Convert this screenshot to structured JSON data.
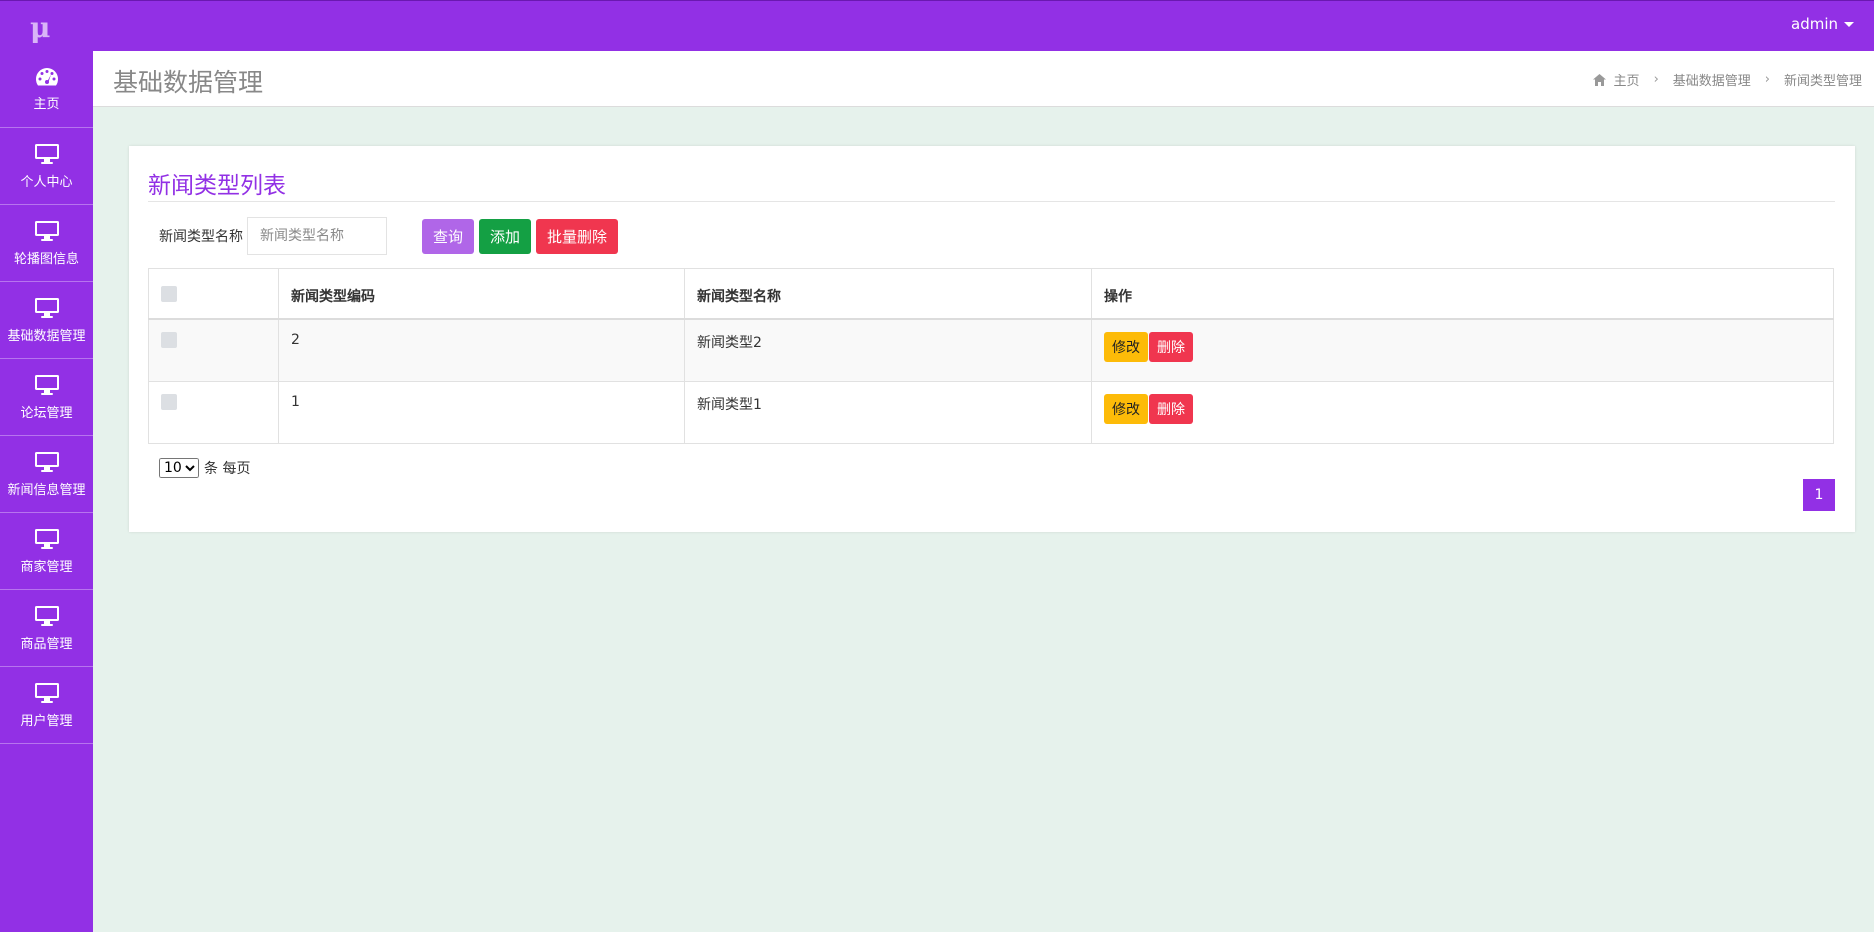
{
  "app": {
    "logo": "μ",
    "user": "admin"
  },
  "colors": {
    "brand": "#9230e5",
    "content_bg": "#e6f2ec",
    "query": "#b066e8",
    "add": "#14a044",
    "delete": "#f0364f",
    "edit": "#fdbb08"
  },
  "sidebar": {
    "items": [
      {
        "label": "主页",
        "icon": "dashboard-icon"
      },
      {
        "label": "个人中心",
        "icon": "monitor-icon"
      },
      {
        "label": "轮播图信息",
        "icon": "monitor-icon"
      },
      {
        "label": "基础数据管理",
        "icon": "monitor-icon"
      },
      {
        "label": "论坛管理",
        "icon": "monitor-icon"
      },
      {
        "label": "新闻信息管理",
        "icon": "monitor-icon"
      },
      {
        "label": "商家管理",
        "icon": "monitor-icon"
      },
      {
        "label": "商品管理",
        "icon": "monitor-icon"
      },
      {
        "label": "用户管理",
        "icon": "monitor-icon"
      }
    ]
  },
  "header": {
    "title": "基础数据管理",
    "breadcrumb": [
      "主页",
      "基础数据管理",
      "新闻类型管理"
    ]
  },
  "card": {
    "title": "新闻类型列表",
    "search": {
      "label": "新闻类型名称",
      "placeholder": "新闻类型名称",
      "value": ""
    },
    "buttons": {
      "query": "查询",
      "add": "添加",
      "batch_delete": "批量删除"
    }
  },
  "table": {
    "columns": [
      "新闻类型编码",
      "新闻类型名称",
      "操作"
    ],
    "rows": [
      {
        "code": "2",
        "name": "新闻类型2"
      },
      {
        "code": "1",
        "name": "新闻类型1"
      }
    ],
    "row_actions": {
      "edit": "修改",
      "delete": "删除"
    }
  },
  "pagination": {
    "page_size": "10",
    "page_size_options": [
      "10"
    ],
    "page_size_suffix": "条 每页",
    "current_page": "1"
  }
}
